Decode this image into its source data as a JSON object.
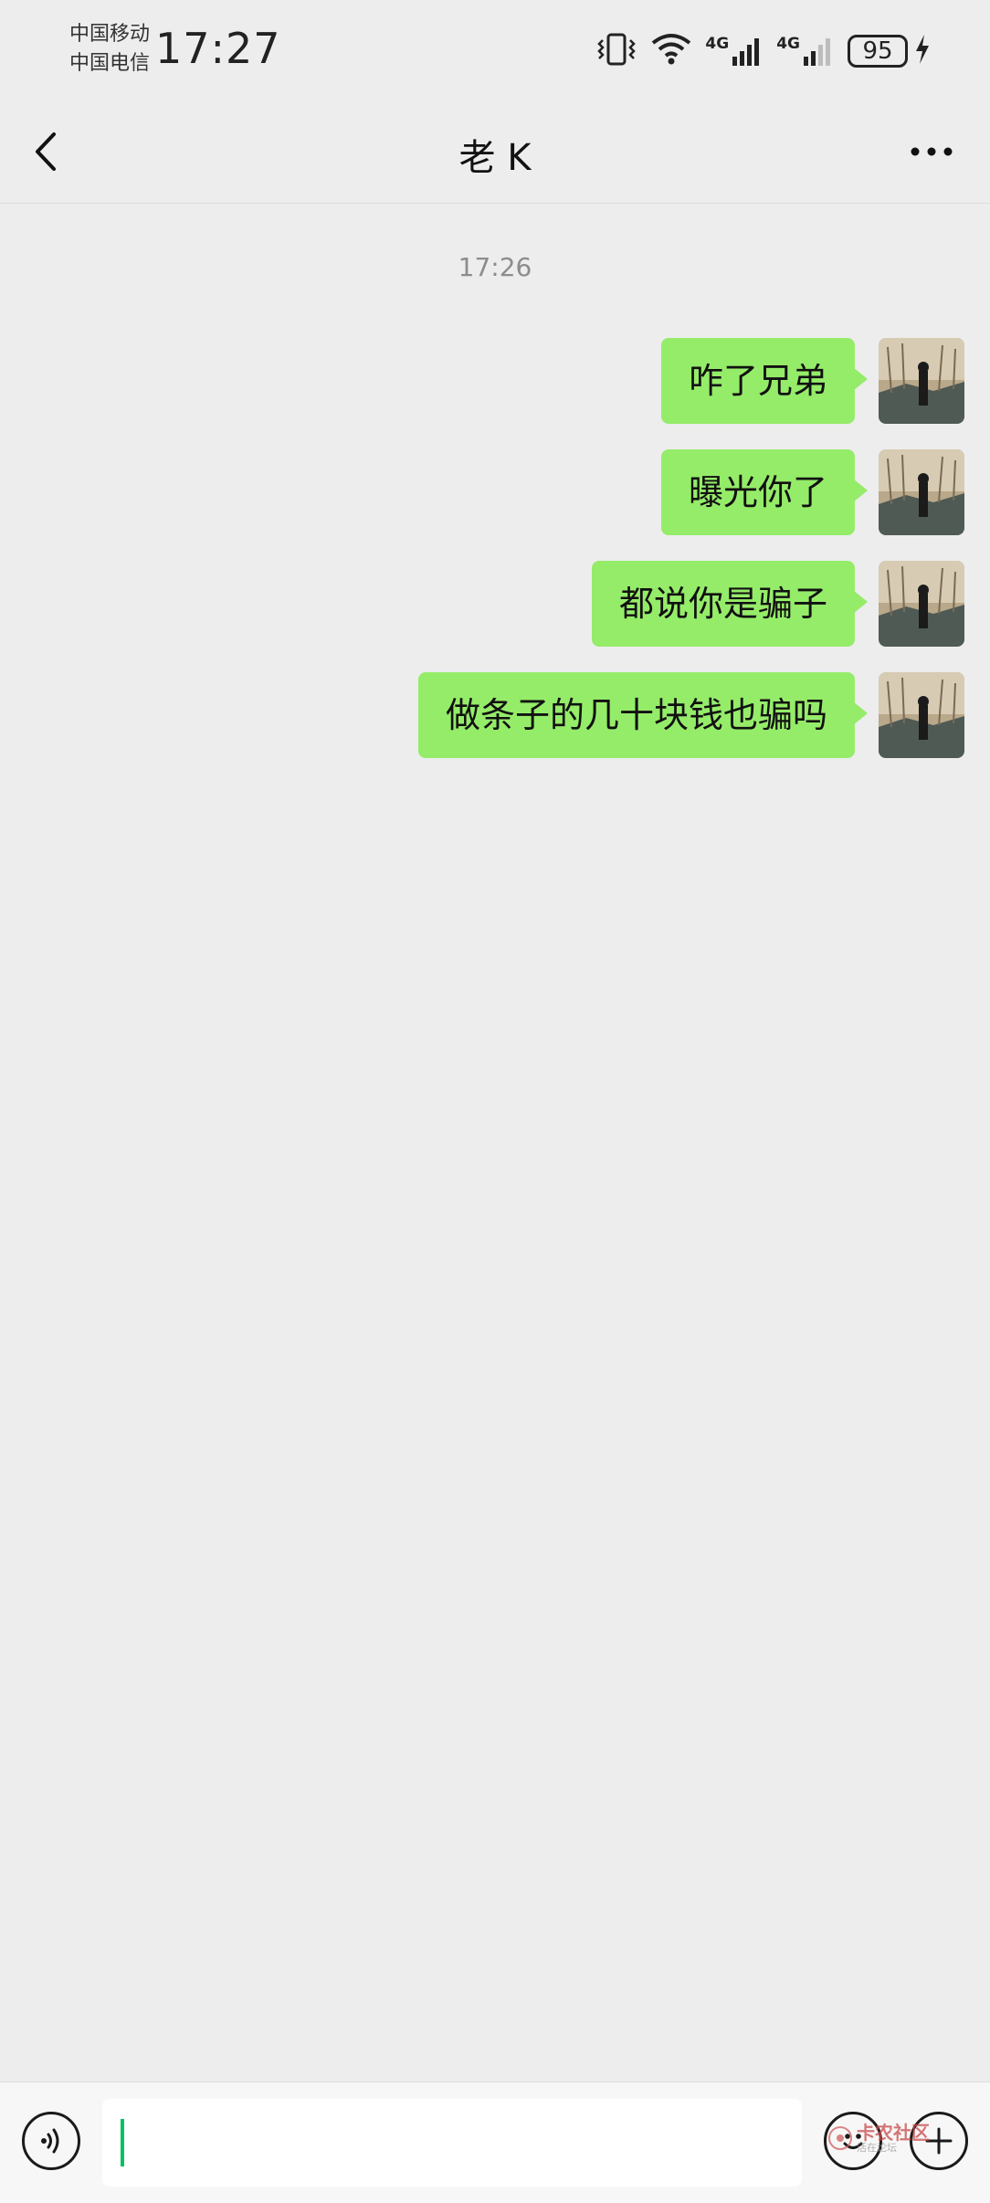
{
  "status_bar": {
    "carrier_1": "中国移动",
    "carrier_2": "中国电信",
    "time": "17:27",
    "signal_1_label": "4G",
    "signal_2_label": "4G",
    "battery": "95",
    "icons": [
      "vibrate-icon",
      "wifi-icon",
      "signal-icon",
      "signal-icon",
      "battery-icon",
      "charging-icon"
    ]
  },
  "header": {
    "title": "老 K",
    "back_icon": "chevron-left-icon",
    "more_icon": "more-icon"
  },
  "chat": {
    "timestamp": "17:26",
    "messages": [
      {
        "text": "咋了兄弟",
        "sender": "self"
      },
      {
        "text": "曝光你了",
        "sender": "self"
      },
      {
        "text": "都说你是骗子",
        "sender": "self"
      },
      {
        "text": "做条子的几十块钱也骗吗",
        "sender": "self"
      }
    ],
    "bubble_color": "#95ec69"
  },
  "input_bar": {
    "value": "",
    "cursor_color": "#07c160",
    "icons": [
      "voice-icon",
      "emoji-icon",
      "plus-icon"
    ]
  },
  "watermark": {
    "main": "卡农社区",
    "sub": "活在论坛"
  }
}
